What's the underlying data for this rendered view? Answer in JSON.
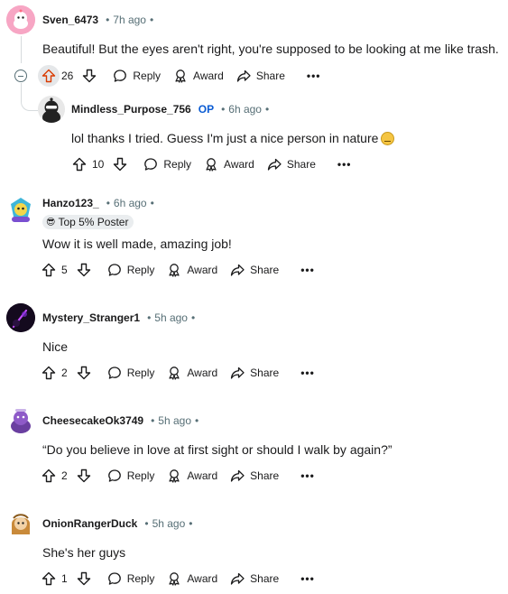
{
  "actions_labels": {
    "reply": "Reply",
    "award": "Award",
    "share": "Share",
    "more": "•••"
  },
  "comments": [
    {
      "username": "Sven_6473",
      "time": "7h ago",
      "text": "Beautiful! But the eyes aren't right, you're supposed to be looking at me like trash.",
      "votes": "26",
      "upvoted": true
    },
    {
      "username": "Mindless_Purpose_756",
      "op": "OP",
      "time": "6h ago",
      "text": "lol thanks I tried. Guess I'm just a nice person in nature",
      "votes": "10"
    },
    {
      "username": "Hanzo123_",
      "time": "6h ago",
      "flair": "Top 5% Poster",
      "text": "Wow it is well made, amazing job!",
      "votes": "5"
    },
    {
      "username": "Mystery_Stranger1",
      "time": "5h ago",
      "text": "Nice",
      "votes": "2"
    },
    {
      "username": "CheesecakeOk3749",
      "time": "5h ago",
      "text": "“Do you believe in love at first sight or should I walk by again?”",
      "votes": "2"
    },
    {
      "username": "OnionRangerDuck",
      "time": "5h ago",
      "text": "She's her guys",
      "votes": "1"
    }
  ],
  "colors": {
    "upvote_active": "#d93a00",
    "text": "#1a1a1b",
    "meta": "#576f76",
    "op": "#0a5bd3"
  }
}
